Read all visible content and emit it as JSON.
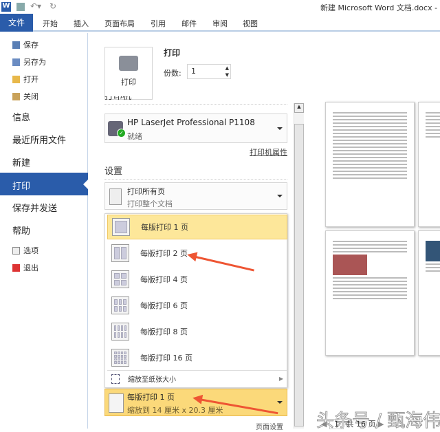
{
  "titlebar": {
    "title": "新建 Microsoft Word 文档.docx - M"
  },
  "ribbon": {
    "file_tab": "文件",
    "tabs": [
      "开始",
      "插入",
      "页面布局",
      "引用",
      "邮件",
      "审阅",
      "视图"
    ]
  },
  "nav": {
    "small_top": [
      "保存",
      "另存为",
      "打开",
      "关闭"
    ],
    "main": [
      "信息",
      "最近所用文件",
      "新建",
      "打印",
      "保存并发送",
      "帮助"
    ],
    "small_bottom": [
      "选项",
      "退出"
    ]
  },
  "print": {
    "heading": "打印",
    "button": "打印",
    "copies_label": "份数:",
    "copies_value": "1"
  },
  "printer": {
    "section": "打印机",
    "name": "HP LaserJet Professional P1108",
    "status": "就绪",
    "properties_link": "打印机属性"
  },
  "settings": {
    "heading": "设置",
    "range_title": "打印所有页",
    "range_sub": "打印整个文档",
    "pages_per_sheet_options": [
      "每版打印 1 页",
      "每版打印 2 页",
      "每版打印 4 页",
      "每版打印 6 页",
      "每版打印 8 页",
      "每版打印 16 页"
    ],
    "scale_option": "缩放至纸张大小",
    "selected_title": "每版打印 1 页",
    "selected_sub": "缩放到 14 厘米 x 20.3 厘米",
    "page_setup_link": "页面设置"
  },
  "preview": {
    "current_page": "1",
    "total": "共 16 页"
  },
  "watermark": "头条号 / 甄海伟"
}
